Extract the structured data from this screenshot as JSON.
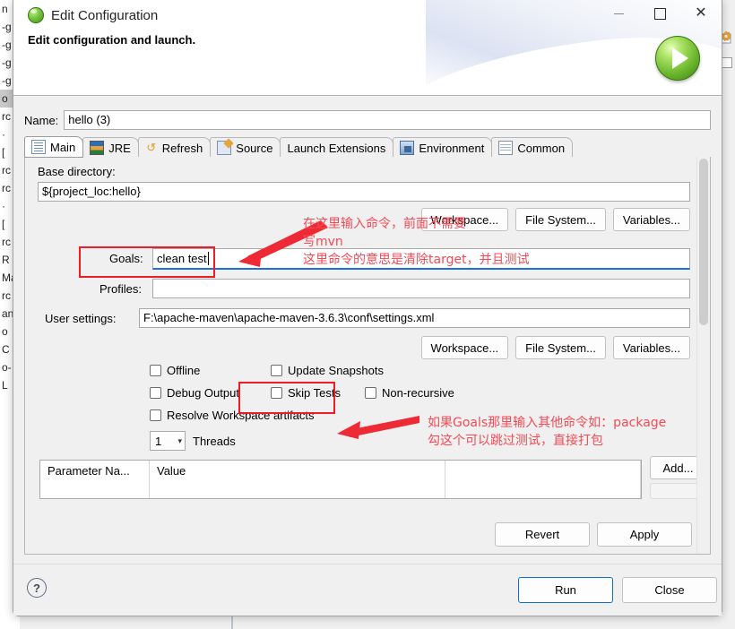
{
  "background": {
    "left_lines": [
      "n",
      "-g",
      "-g",
      "-g",
      "-g",
      "o",
      "rc",
      "·",
      "[",
      "rc",
      "rc",
      "·",
      "[",
      "rc",
      "R",
      "Ma",
      "rc",
      "an",
      "o",
      "C",
      "o-",
      "L"
    ],
    "selected_line_index": 5
  },
  "window": {
    "title": "Edit Configuration",
    "title_icon": "maven-green-icon",
    "subtitle": "Edit configuration and launch.",
    "minimize_label": "—",
    "maximize_label": "",
    "close_label": "✕",
    "run_icon": "green-play-icon"
  },
  "name": {
    "label": "Name:",
    "value": "hello (3)",
    "placeholder": ""
  },
  "tabs": [
    {
      "label": "Main",
      "icon": "main-document-icon",
      "active": true
    },
    {
      "label": "JRE",
      "icon": "jre-books-icon",
      "active": false
    },
    {
      "label": "Refresh",
      "icon": "refresh-arrows-icon",
      "active": false
    },
    {
      "label": "Source",
      "icon": "source-pencil-icon",
      "active": false
    },
    {
      "label": "Launch Extensions",
      "icon": "",
      "active": false
    },
    {
      "label": "Environment",
      "icon": "environment-monitor-icon",
      "active": false
    },
    {
      "label": "Common",
      "icon": "common-table-icon",
      "active": false
    }
  ],
  "main_tab": {
    "base_directory": {
      "label": "Base directory:",
      "value": "${project_loc:hello}",
      "placeholder": ""
    },
    "buttons_row_1": [
      "Workspace...",
      "File System...",
      "Variables..."
    ],
    "goals": {
      "label": "Goals:",
      "value": "clean test",
      "placeholder": ""
    },
    "profiles": {
      "label": "Profiles:",
      "value": "",
      "placeholder": ""
    },
    "user_settings": {
      "label": "User settings:",
      "value": "F:\\apache-maven\\apache-maven-3.6.3\\conf\\settings.xml",
      "placeholder": ""
    },
    "buttons_row_2": [
      "Workspace...",
      "File System...",
      "Variables..."
    ],
    "checkboxes": [
      {
        "label": "Offline",
        "checked": false
      },
      {
        "label": "Update Snapshots",
        "checked": false
      },
      {
        "label": "Debug Output",
        "checked": false
      },
      {
        "label": "Skip Tests",
        "checked": false
      },
      {
        "label": "Non-recursive",
        "checked": false
      },
      {
        "label": "Resolve Workspace artifacts",
        "checked": false
      }
    ],
    "threads": {
      "value": "1",
      "label": "Threads",
      "arrow_icon": "chevron-down-icon"
    },
    "parameter_table": {
      "columns": [
        "Parameter Na...",
        "Value"
      ],
      "rows": []
    },
    "add_button": "Add...",
    "revert_button": "Revert",
    "apply_button": "Apply"
  },
  "footer": {
    "help_icon": "question-mark-icon",
    "help_label": "?",
    "run_button": "Run",
    "close_button": "Close"
  },
  "annotations": {
    "color": "#f24b56",
    "box_color": "#ee1c24",
    "text_1": "在这里输入命令，前面不需要",
    "text_2": "写mvn",
    "text_3": "这里命令的意思是清除target，并且测试",
    "text_4": "如果Goals那里输入其他命令如：package",
    "text_5": "勾这个可以跳过测试，直接打包",
    "boxed_targets": [
      "goals-field",
      "skip-tests-checkbox"
    ]
  }
}
